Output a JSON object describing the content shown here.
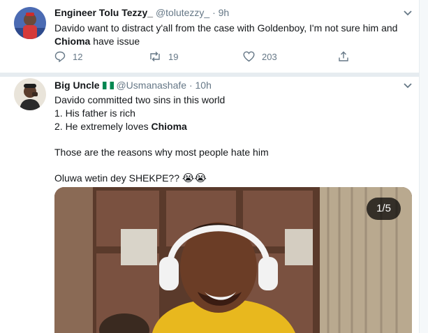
{
  "tweets": [
    {
      "author_name": "Engineer Tolu Tezzy_",
      "handle": "@tolutezzy_",
      "time": "· 9h",
      "text_line1": "Davido want to distract y'all from the case with Goldenboy, I'm not sure him and",
      "text_line2_bold": "Chioma",
      "text_line2_rest": " have issue",
      "reply_count": "12",
      "retweet_count": "19",
      "like_count": "203"
    },
    {
      "author_name": "Big Uncle",
      "handle": "@Usmanashafe",
      "time": "· 10h",
      "line1": "Davido committed two sins in this world",
      "line2": "1. His father is rich",
      "line3_prefix": "2. He extremely loves ",
      "line3_bold": "Chioma",
      "line4": "Those are the reasons why most people hate him",
      "line5": "Oluwa wetin dey SHEKPE??",
      "emojis": "😭😭",
      "media_counter": "1/5"
    }
  ],
  "colors": {
    "text": "#14171a",
    "secondary": "#657786",
    "divider": "#e6ecf0"
  },
  "icons": [
    "reply-icon",
    "retweet-icon",
    "like-icon",
    "share-icon",
    "chevron-down-icon",
    "nigeria-flag-icon"
  ]
}
